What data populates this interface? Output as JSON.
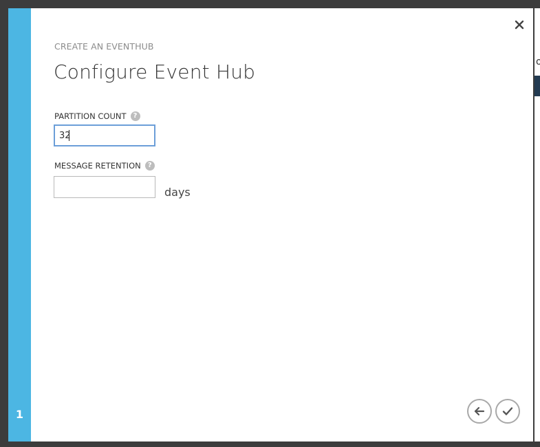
{
  "background": {
    "peek_text": "o"
  },
  "dialog": {
    "step_number": "1",
    "breadcrumb": "CREATE AN EVENTHUB",
    "title": "Configure Event Hub",
    "fields": {
      "partition_count": {
        "label": "PARTITION COUNT",
        "value": "32",
        "help_icon": "question-icon"
      },
      "message_retention": {
        "label": "MESSAGE RETENTION",
        "value": "",
        "unit": "days",
        "help_icon": "question-icon"
      }
    },
    "buttons": {
      "close": "close-icon",
      "back": "arrow-left-icon",
      "finish": "checkmark-icon"
    }
  },
  "colors": {
    "accent": "#4cb6e3",
    "focus_border": "#6b9ed8",
    "overlay": "#3c3c3c"
  }
}
